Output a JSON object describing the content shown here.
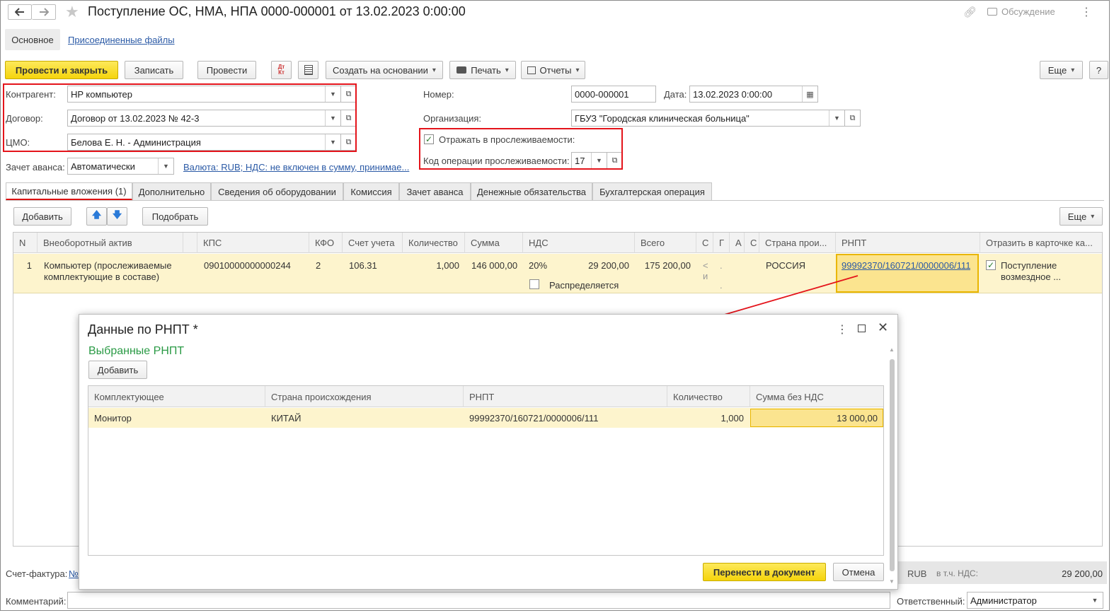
{
  "window": {
    "title": "Поступление ОС, НМА, НПА 0000-000001 от 13.02.2023 0:00:00",
    "discussion": "Обсуждение"
  },
  "section_tabs": [
    "Основное",
    "Присоединенные файлы"
  ],
  "toolbar": {
    "post_close": "Провести и закрыть",
    "save": "Записать",
    "post": "Провести",
    "create_based": "Создать на основании",
    "print": "Печать",
    "reports": "Отчеты",
    "more": "Еще",
    "help": "?",
    "dtkt_icon": "Дт Кт"
  },
  "header": {
    "counterparty_label": "Контрагент:",
    "counterparty_value": "HP компьютер",
    "contract_label": "Договор:",
    "contract_value": "Договор от 13.02.2023 № 42-3",
    "cmo_label": "ЦМО:",
    "cmo_value": "Белова Е. Н. - Администрация",
    "advance_label": "Зачет аванса:",
    "advance_value": "Автоматически",
    "currency_link": "Валюта: RUB; НДС: не включен в сумму, принимае...",
    "number_label": "Номер:",
    "number_value": "0000-000001",
    "date_label": "Дата:",
    "date_value": "13.02.2023  0:00:00",
    "org_label": "Организация:",
    "org_value": "ГБУЗ \"Городская клиническая больница\"",
    "trace_label": "Отражать в прослеживаемости:",
    "trace_code_label": "Код операции прослеживаемости:",
    "trace_code_value": "17"
  },
  "tabs": [
    "Капитальные вложения (1)",
    "Дополнительно",
    "Сведения об оборудовании",
    "Комиссия",
    "Зачет аванса",
    "Денежные обязательства",
    "Бухгалтерская операция"
  ],
  "table_toolbar": {
    "add": "Добавить",
    "pick": "Подобрать",
    "more": "Еще"
  },
  "table": {
    "columns": [
      "N",
      "Внеоборотный актив",
      "КПС",
      "КФО",
      "Счет учета",
      "Количество",
      "Сумма",
      "НДС",
      "Всего",
      "С",
      "Г",
      "А",
      "С",
      "Страна прои...",
      "РНПТ",
      "Отразить в карточке ка..."
    ],
    "row": {
      "n": "1",
      "asset": "Компьютер (прослеживаемые комплектующие в составе)",
      "kps": "09010000000000244",
      "kfo": "2",
      "account": "106.31",
      "qty": "1,000",
      "sum": "146 000,00",
      "vat_rate": "20%",
      "vat_sum": "29 200,00",
      "distribute": "Распределяется",
      "total": "175 200,00",
      "c1": "<",
      "c1b": "и",
      "c2": ".",
      "c2b": ".",
      "country": "РОССИЯ",
      "rnpt": "99992370/160721/0000006/111",
      "card": "Поступление возмездное ..."
    }
  },
  "dialog": {
    "title": "Данные по РНПТ *",
    "subtitle": "Выбранные РНПТ",
    "add": "Добавить",
    "columns": [
      "Комплектующее",
      "Страна происхождения",
      "РНПТ",
      "Количество",
      "Сумма без НДС"
    ],
    "row": {
      "component": "Монитор",
      "country": "КИТАЙ",
      "rnpt": "99992370/160721/0000006/111",
      "qty": "1,000",
      "sum": "13 000,00"
    },
    "transfer": "Перенести в документ",
    "cancel": "Отмена"
  },
  "footer": {
    "invoice_label": "Счет-фактура:",
    "invoice_link": "№",
    "currency": "RUB",
    "vat_label": "в т.ч. НДС:",
    "vat_value": "29 200,00",
    "comment_label": "Комментарий:",
    "responsible_label": "Ответственный:",
    "responsible_value": "Администратор"
  },
  "colors": {
    "accent_yellow": "#f5d40c",
    "highlight_row": "#fdf4cd",
    "red_annotation": "#e4141b",
    "link": "#2b5aa6",
    "green_title": "#2a9a45"
  }
}
